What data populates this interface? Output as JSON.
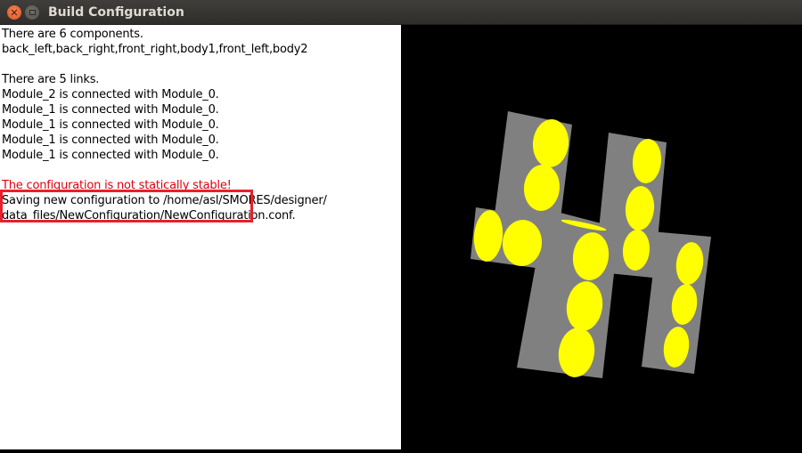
{
  "window": {
    "title": "Build Configuration",
    "close_icon": "close-icon",
    "maximize_icon": "maximize-icon"
  },
  "log": {
    "lines": [
      "There are 6 components.",
      "back_left,back_right,front_right,body1,front_left,body2",
      "",
      "There are 5 links.",
      "Module_2 is connected with Module_0.",
      "Module_1 is connected with Module_0.",
      "Module_1 is connected with Module_0.",
      "Module_1 is connected with Module_0.",
      "Module_1 is connected with Module_0.",
      "",
      "The configuration is not statically stable!",
      "Saving new configuration to /home/asl/SMORES/designer/",
      "data_files/NewConfiguration/NewConfiguration.conf."
    ],
    "warning_color": "#e0000a",
    "highlight_color": "#e8202a"
  },
  "viewport": {
    "background": "#000000",
    "body_color": "#808080",
    "wheel_color": "#ffff00"
  }
}
